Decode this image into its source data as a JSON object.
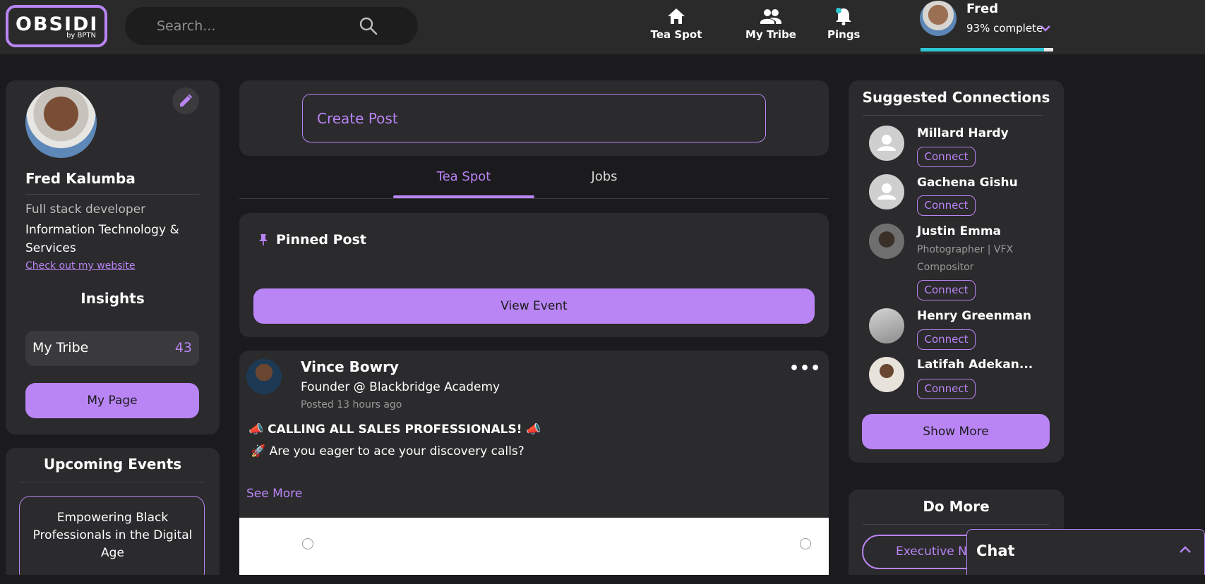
{
  "header": {
    "logo_text": "OBSIDI",
    "logo_sub": "by BPTN",
    "search_placeholder": "Search...",
    "nav": [
      {
        "label": "Tea Spot",
        "icon": "home-icon"
      },
      {
        "label": "My Tribe",
        "icon": "people-icon"
      },
      {
        "label": "Pings",
        "icon": "bell-icon"
      }
    ],
    "user": {
      "name": "Fred",
      "completion_text": "93% complete",
      "completion": 0.93
    }
  },
  "profile": {
    "full_name": "Fred Kalumba",
    "role": "Full stack developer",
    "industry": "Information Technology & Services",
    "website_link": "Check out my website",
    "insights_title": "Insights",
    "tribe_label": "My Tribe",
    "tribe_count": "43",
    "my_page_button": "My Page"
  },
  "events": {
    "title": "Upcoming Events",
    "items": [
      {
        "title": "Empowering Black Professionals in the Digital Age"
      }
    ]
  },
  "feed": {
    "create_post_placeholder": "Create Post",
    "tabs": [
      {
        "label": "Tea Spot",
        "active": true
      },
      {
        "label": "Jobs",
        "active": false
      }
    ],
    "pinned_label": "Pinned Post",
    "view_event_button": "View Event",
    "post": {
      "author": "Vince Bowry",
      "author_title": "Founder @ Blackbridge Academy",
      "posted": "Posted 13 hours ago",
      "line1": "📣 CALLING ALL SALES PROFESSIONALS! 📣",
      "line2": "🚀 Are you eager to ace your discovery calls?",
      "see_more": "See More"
    }
  },
  "suggestions": {
    "title": "Suggested Connections",
    "connect_label": "Connect",
    "people": [
      {
        "name": "Millard Hardy",
        "subtitle": ""
      },
      {
        "name": "Gachena Gishu",
        "subtitle": ""
      },
      {
        "name": "Justin Emma",
        "subtitle": "Photographer | VFX Compositor"
      },
      {
        "name": "Henry Greenman",
        "subtitle": ""
      },
      {
        "name": "Latifah Adekan...",
        "subtitle": ""
      }
    ],
    "show_more_button": "Show More"
  },
  "do_more": {
    "title": "Do More",
    "button": "Executive Ne"
  },
  "chat": {
    "label": "Chat"
  },
  "colors": {
    "accent": "#b985f5",
    "background": "#1b1a1c",
    "card": "#2b2a2c",
    "progress": "#2dc5d1"
  }
}
